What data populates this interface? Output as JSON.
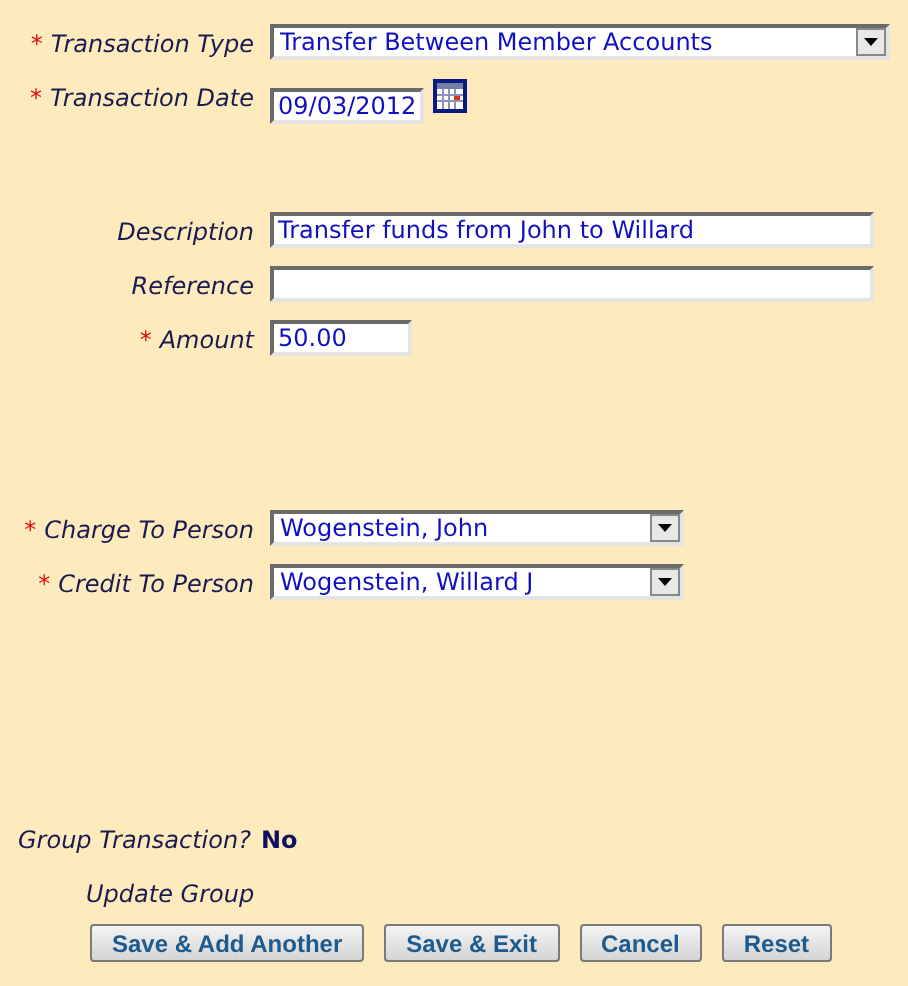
{
  "sections": [
    {
      "fields": [
        {
          "kind": "select",
          "marker": "*",
          "label": "Transaction Type",
          "value": "Transfer Between Member Accounts"
        },
        {
          "kind": "date",
          "marker": "*",
          "label": "Transaction Date",
          "value": "09/03/2012"
        }
      ]
    },
    {
      "fields": [
        {
          "kind": "text",
          "label": "Description",
          "value": "Transfer funds from John to Willard"
        },
        {
          "kind": "text",
          "label": "Reference"
        },
        {
          "kind": "text",
          "marker": "*",
          "label": "Amount",
          "value": "50.00"
        }
      ]
    },
    {
      "fields": [
        {
          "kind": "select",
          "marker": "*",
          "label": "Charge To Person",
          "value": "Wogenstein, John"
        },
        {
          "kind": "select",
          "marker": "*",
          "label": "Credit To Person",
          "value": "Wogenstein, Willard J"
        }
      ]
    }
  ],
  "group_transaction": {
    "label": "Group Transaction?",
    "value": "No"
  },
  "update_group": "Update Group",
  "buttons": [
    "Save & Add Another",
    "Save & Exit",
    "Cancel",
    "Reset"
  ]
}
